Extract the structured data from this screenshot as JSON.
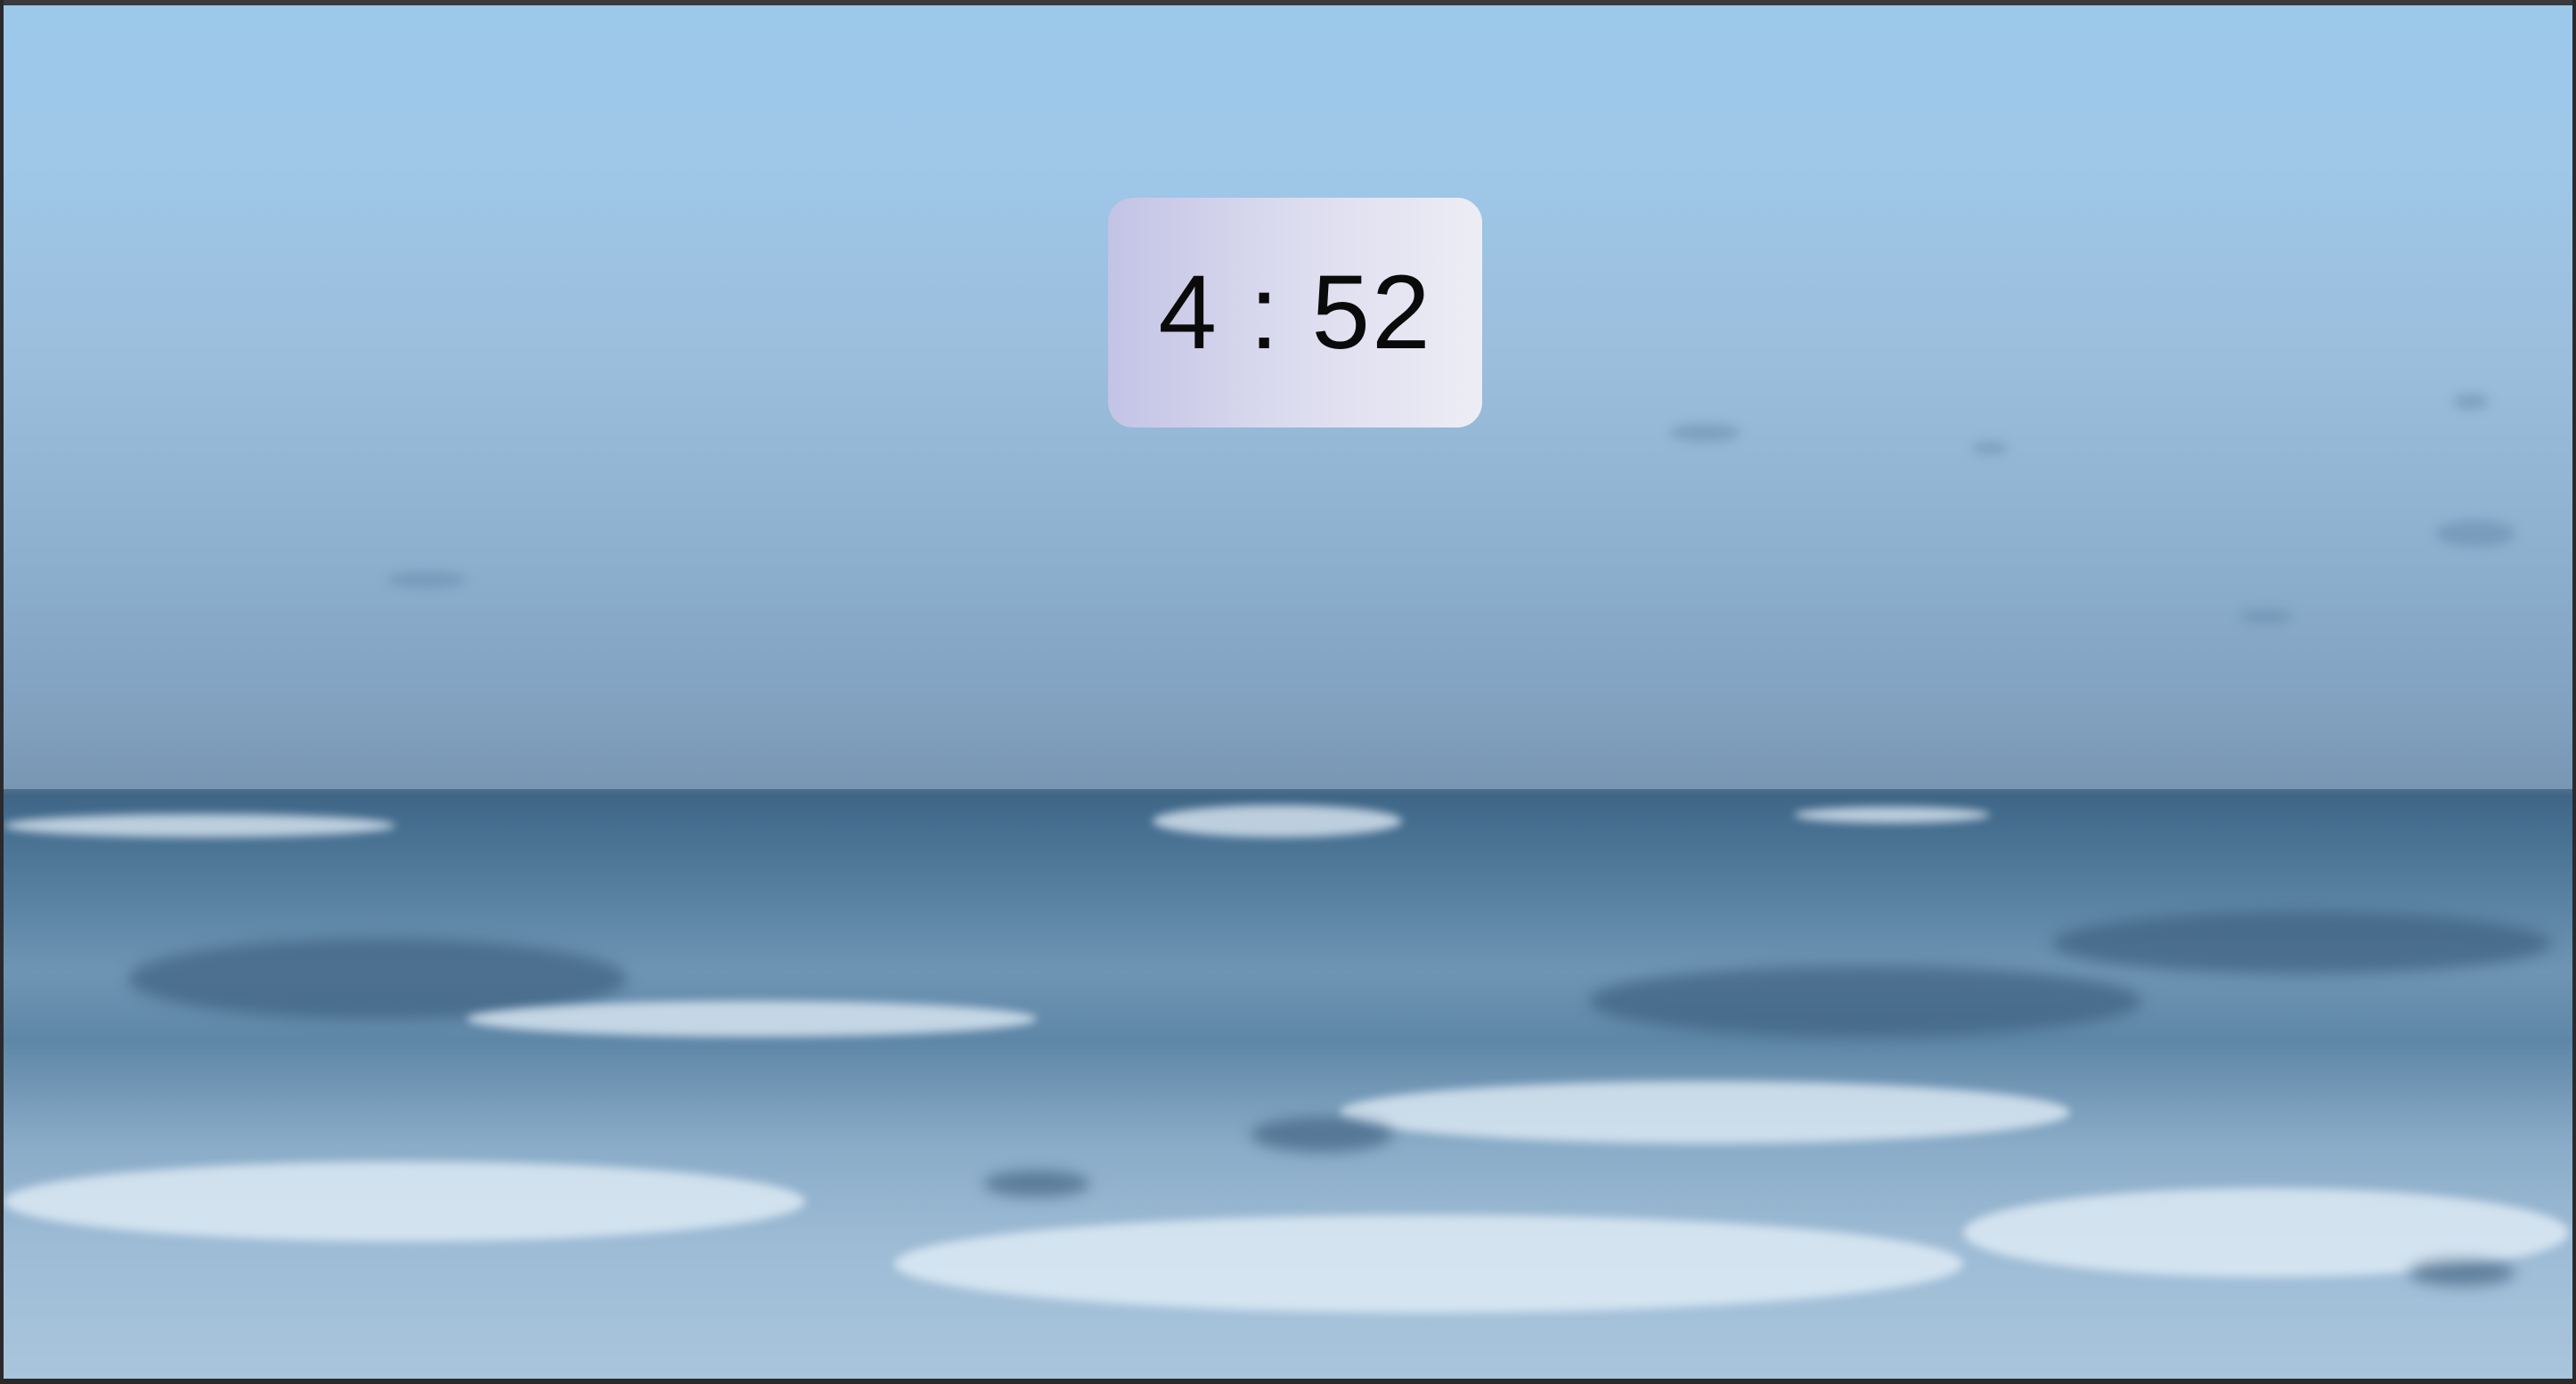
{
  "timer": {
    "display": "4 : 52"
  },
  "background": {
    "scene": "ocean-horizon-background",
    "sky_color": "#9cc8ea",
    "sea_color": "#4f7899",
    "foam_color": "#e6f0f8"
  },
  "card": {
    "gradient_start": "#c3c3e6",
    "gradient_end": "#ededf5",
    "text_color": "#0a0a0a"
  }
}
